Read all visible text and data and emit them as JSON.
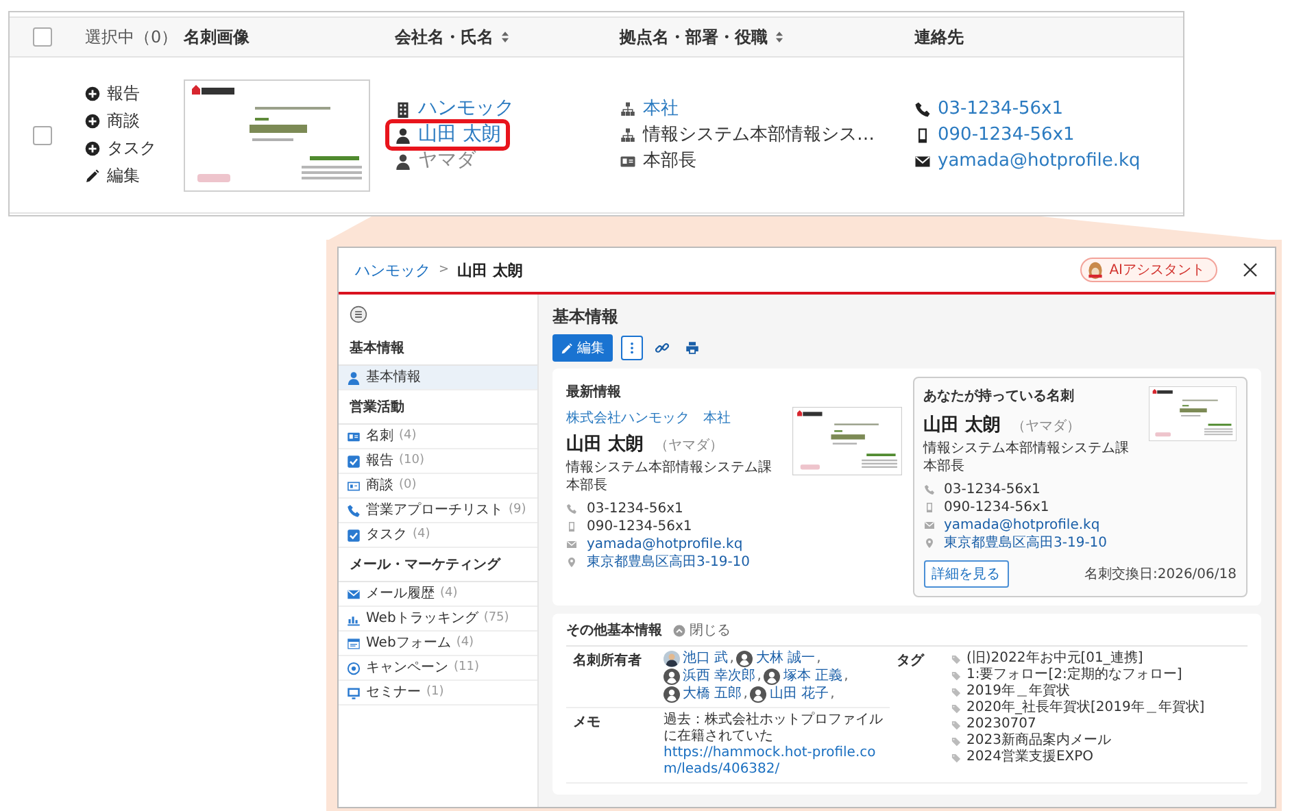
{
  "table": {
    "select_all": {
      "checked": false
    },
    "columns": [
      {
        "kind": "selection",
        "label": "選択中（0）",
        "sortable": false
      },
      {
        "kind": "heading",
        "label": "名刺画像",
        "sortable": false
      },
      {
        "kind": "heading",
        "label": "会社名・氏名",
        "sortable": true
      },
      {
        "kind": "heading",
        "label": "拠点名・部署・役職",
        "sortable": true
      },
      {
        "kind": "heading",
        "label": "連絡先",
        "sortable": false
      }
    ],
    "rows": [
      {
        "checked": false,
        "actions": [
          {
            "kind": "add",
            "label": "報告"
          },
          {
            "kind": "add",
            "label": "商談"
          },
          {
            "kind": "add",
            "label": "タスク"
          },
          {
            "kind": "edit",
            "label": "編集"
          }
        ],
        "card_image": {
          "kind": "picture"
        },
        "names": [
          {
            "kind": "company",
            "text": "ハンモック",
            "link": true,
            "highlighted": false
          },
          {
            "kind": "person",
            "text": "山田 太朗",
            "link": true,
            "highlighted": true
          },
          {
            "kind": "kana",
            "text": "ヤマダ",
            "link": false,
            "highlighted": false
          }
        ],
        "organization": [
          {
            "kind": "branch",
            "text": "本社",
            "link": true
          },
          {
            "kind": "department",
            "text": "情報システム本部情報シス…",
            "link": false
          },
          {
            "kind": "title",
            "text": "本部長",
            "link": false
          }
        ],
        "contacts": [
          {
            "kind": "phone",
            "text": "03-1234-56x1",
            "link": true
          },
          {
            "kind": "mobile",
            "text": "090-1234-56x1",
            "link": true
          },
          {
            "kind": "email",
            "text": "yamada@hotprofile.kq",
            "link": true
          }
        ]
      }
    ]
  },
  "detail": {
    "breadcrumb": [
      {
        "text": "ハンモック",
        "link": true
      },
      {
        "text": "山田 太朗",
        "link": false
      }
    ],
    "breadcrumb_separator": ">",
    "assistant_button": "AIアシスタント",
    "sidebar": {
      "sections": [
        {
          "title": "基本情報",
          "items": [
            {
              "kind": "profile",
              "label": "基本情報",
              "selected": true
            }
          ]
        },
        {
          "title": "営業活動",
          "items": [
            {
              "kind": "card",
              "label": "名刺",
              "count": "(4)",
              "selected": false
            },
            {
              "kind": "report",
              "label": "報告",
              "count": "(10)",
              "selected": false
            },
            {
              "kind": "deal",
              "label": "商談",
              "count": "(0)",
              "selected": false
            },
            {
              "kind": "call-list",
              "label": "営業アプローチリスト",
              "count": "(9)",
              "selected": false
            },
            {
              "kind": "task",
              "label": "タスク",
              "count": "(4)",
              "selected": false
            }
          ]
        },
        {
          "title": "メール・マーケティング",
          "items": [
            {
              "kind": "mail",
              "label": "メール履歴",
              "count": "(4)",
              "selected": false
            },
            {
              "kind": "tracking",
              "label": "Webトラッキング",
              "count": "(75)",
              "selected": false
            },
            {
              "kind": "form",
              "label": "Webフォーム",
              "count": "(4)",
              "selected": false
            },
            {
              "kind": "campaign",
              "label": "キャンペーン",
              "count": "(11)",
              "selected": false
            },
            {
              "kind": "seminar",
              "label": "セミナー",
              "count": "(1)",
              "selected": false
            }
          ]
        }
      ]
    },
    "page_title": "基本情報",
    "edit_button": "編集",
    "latest": {
      "title": "最新情報",
      "company": "株式会社ハンモック　本社",
      "name": "山田 太朗",
      "kana": "（ヤマダ）",
      "department": "情報システム本部情報システム課",
      "position": "本部長",
      "card_image": {
        "kind": "picture"
      },
      "contacts": [
        {
          "kind": "phone",
          "text": "03-1234-56x1",
          "link": false
        },
        {
          "kind": "mobile",
          "text": "090-1234-56x1",
          "link": false
        },
        {
          "kind": "email",
          "text": "yamada@hotprofile.kq",
          "link": true
        },
        {
          "kind": "address",
          "text": "東京都豊島区高田3-19-10",
          "link": true
        }
      ]
    },
    "owned_card": {
      "title": "あなたが持っている名刺",
      "name": "山田 太朗",
      "kana": "（ヤマダ）",
      "department": "情報システム本部情報システム課",
      "position": "本部長",
      "card_image": {
        "kind": "picture"
      },
      "contacts": [
        {
          "kind": "phone",
          "text": "03-1234-56x1",
          "link": false
        },
        {
          "kind": "mobile",
          "text": "090-1234-56x1",
          "link": false
        },
        {
          "kind": "email",
          "text": "yamada@hotprofile.kq",
          "link": true
        },
        {
          "kind": "address",
          "text": "東京都豊島区高田3-19-10",
          "link": true
        }
      ],
      "details_button": "詳細を見る",
      "exchange_date": "名刺交換日:2026/06/18"
    },
    "other_info": {
      "title": "その他基本情報",
      "toggle": "閉じる",
      "fields": [
        {
          "kind": "owners",
          "label": "名刺所有者",
          "owners": [
            {
              "name": "池口 武",
              "separator": ","
            },
            {
              "name": "大林 誠一",
              "kind": "default",
              "separator": ","
            },
            {
              "name": "浜西 幸次郎",
              "kind": "default",
              "separator": ","
            },
            {
              "name": "塚本 正義",
              "kind": "default",
              "separator": ","
            },
            {
              "name": "大橋 五郎",
              "kind": "default",
              "separator": ","
            },
            {
              "name": "山田 花子",
              "kind": "default",
              "separator": ","
            }
          ]
        },
        {
          "kind": "memo",
          "label": "メモ",
          "text": "過去：株式会社ホットプロファイルに在籍されていた",
          "link": "https://hammock.hot-profile.com/leads/406382/"
        },
        {
          "kind": "tags",
          "label": "タグ",
          "tags": [
            "(旧)2022年お中元[01_連携]",
            "1:要フォロー[2:定期的なフォロー]",
            "2019年＿年賀状",
            "2020年_社長年賀状[2019年＿年賀状]",
            "20230707",
            "2023新商品案内メール",
            "2024営業支援EXPO"
          ]
        }
      ]
    }
  }
}
